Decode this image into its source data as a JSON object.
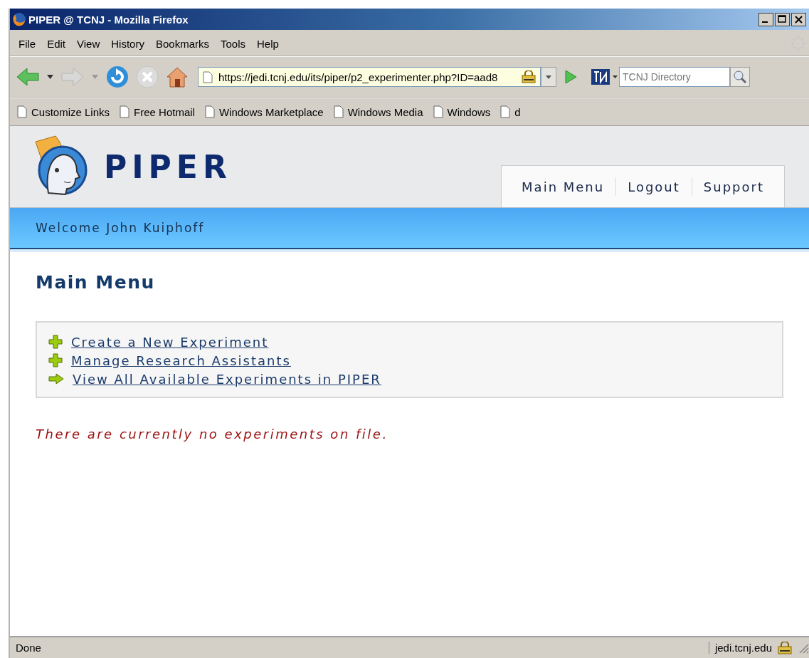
{
  "window": {
    "title": "PIPER @ TCNJ - Mozilla Firefox"
  },
  "menu_bar": [
    "File",
    "Edit",
    "View",
    "History",
    "Bookmarks",
    "Tools",
    "Help"
  ],
  "address_bar": {
    "value": "https://jedi.tcnj.edu/its/piper/p2_experimenter.php?ID=aad8"
  },
  "search": {
    "placeholder": "TCNJ Directory"
  },
  "bookmarks": [
    "Customize Links",
    "Free Hotmail",
    "Windows Marketplace",
    "Windows Media",
    "Windows",
    "d"
  ],
  "page": {
    "logo": "PIPER",
    "nav": [
      "Main Menu",
      "Logout",
      "Support"
    ],
    "welcome": "Welcome John Kuiphoff",
    "heading": "Main Menu",
    "links": [
      {
        "kind": "plus",
        "label": "Create a New Experiment"
      },
      {
        "kind": "plus",
        "label": "Manage Research Assistants"
      },
      {
        "kind": "arrow",
        "label": "View All Available Experiments in PIPER"
      }
    ],
    "notice": "There are currently no experiments on file."
  },
  "status_bar": {
    "text": "Done",
    "host": "jedi.tcnj.edu"
  }
}
